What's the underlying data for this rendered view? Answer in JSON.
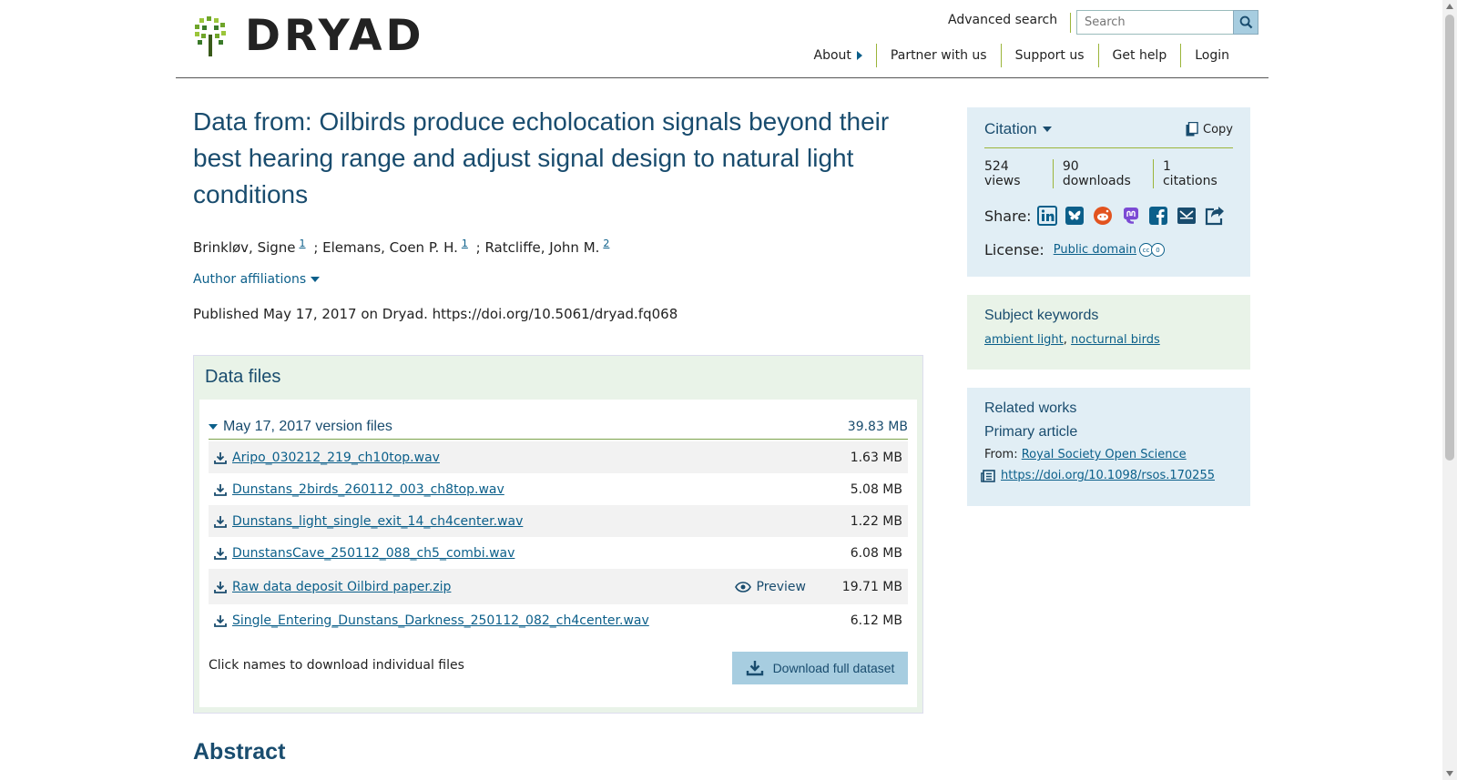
{
  "header": {
    "logo_text": "DRYAD",
    "advanced_search": "Advanced search",
    "search_placeholder": "Search",
    "nav": [
      "About",
      "Partner with us",
      "Support us",
      "Get help",
      "Login"
    ]
  },
  "dataset": {
    "title": "Data from: Oilbirds produce echolocation signals beyond their best hearing range and adjust signal design to natural light conditions",
    "authors": [
      {
        "name": "Brinkløv, Signe",
        "sup": "1"
      },
      {
        "name": "; Elemans, Coen P. H.",
        "sup": "1"
      },
      {
        "name": "; Ratcliffe, John M.",
        "sup": "2"
      }
    ],
    "affiliations_label": "Author affiliations",
    "published": "Published May 17, 2017 on Dryad. https://doi.org/10.5061/dryad.fq068"
  },
  "data_files": {
    "title": "Data files",
    "version_label": "May 17, 2017 version files",
    "version_size": "39.83 MB",
    "files": [
      {
        "name": "Aripo_030212_219_ch10top.wav",
        "size": "1.63 MB"
      },
      {
        "name": "Dunstans_2birds_260112_003_ch8top.wav",
        "size": "5.08 MB"
      },
      {
        "name": "Dunstans_light_single_exit_14_ch4center.wav",
        "size": "1.22 MB"
      },
      {
        "name": "DunstansCave_250112_088_ch5_combi.wav",
        "size": "6.08 MB"
      },
      {
        "name": "Raw data deposit Oilbird paper.zip",
        "size": "19.71 MB",
        "preview": "Preview"
      },
      {
        "name": "Single_Entering_Dunstans_Darkness_250112_082_ch4center.wav",
        "size": "6.12 MB"
      }
    ],
    "click_note": "Click names to download individual files",
    "download_label": "Download full dataset"
  },
  "abstract_title": "Abstract",
  "citation": {
    "title": "Citation",
    "copy": "Copy",
    "metrics": [
      "524 views",
      "90 downloads",
      "1 citations"
    ],
    "share_label": "Share:",
    "license_label": "License:",
    "license_link": "Public domain"
  },
  "keywords": {
    "title": "Subject keywords",
    "items": [
      "ambient light",
      "nocturnal birds"
    ],
    "separator": ", "
  },
  "related": {
    "title": "Related works",
    "subtitle": "Primary article",
    "from_label": "From: ",
    "from_link": "Royal Society Open Science",
    "doi": "https://doi.org/10.1098/rsos.170255"
  },
  "colors": {
    "brand_navy": "#194c6e",
    "link": "#0b5f8a",
    "accent_green": "#9bb53a",
    "panel_blue": "#e1eef5",
    "panel_green": "#e9f3e8",
    "button_blue": "#a7cde0"
  },
  "icons": [
    "search-icon",
    "download-icon",
    "eye-icon",
    "copy-icon",
    "linkedin-icon",
    "bluesky-icon",
    "reddit-icon",
    "mastodon-icon",
    "facebook-icon",
    "email-icon",
    "share-icon",
    "cc-icon",
    "article-icon"
  ]
}
